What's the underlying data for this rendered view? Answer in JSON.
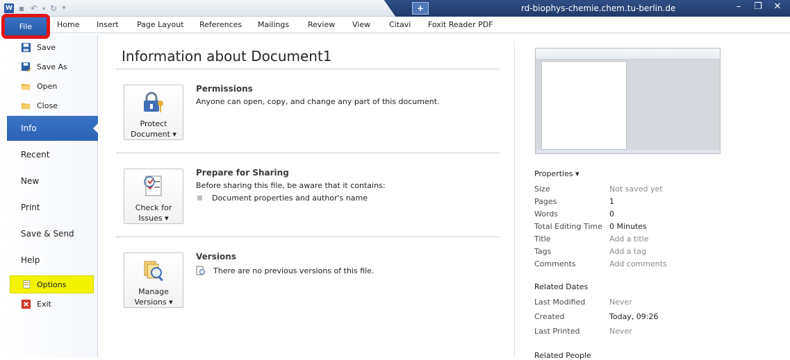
{
  "titlebar": {
    "window_title": "rd-biophys-chemie.chem.tu-berlin.de",
    "app_icon": "W",
    "citavi_symbol": "+"
  },
  "tabs": {
    "file": "File",
    "items": [
      "Home",
      "Insert",
      "Page Layout",
      "References",
      "Mailings",
      "Review",
      "View",
      "Citavi",
      "Foxit Reader PDF"
    ]
  },
  "backstage": {
    "commands": [
      "Save",
      "Save As",
      "Open",
      "Close"
    ],
    "info": "Info",
    "nav": [
      "Recent",
      "New",
      "Print",
      "Save & Send",
      "Help"
    ],
    "options": "Options",
    "exit": "Exit"
  },
  "main": {
    "title": "Information about Document1",
    "permissions": {
      "button_line1": "Protect",
      "button_line2": "Document ▾",
      "title": "Permissions",
      "text": "Anyone can open, copy, and change any part of this document."
    },
    "sharing": {
      "button_line1": "Check for",
      "button_line2": "Issues ▾",
      "title": "Prepare for Sharing",
      "text": "Before sharing this file, be aware that it contains:",
      "bullet": "Document properties and author's name"
    },
    "versions": {
      "button_line1": "Manage",
      "button_line2": "Versions ▾",
      "title": "Versions",
      "text": "There are no previous versions of this file."
    }
  },
  "properties": {
    "header": "Properties ▾",
    "rows": [
      {
        "label": "Size",
        "value": "Not saved yet",
        "muted": true
      },
      {
        "label": "Pages",
        "value": "1",
        "muted": false
      },
      {
        "label": "Words",
        "value": "0",
        "muted": false
      },
      {
        "label": "Total Editing Time",
        "value": "0 Minutes",
        "muted": false
      },
      {
        "label": "Title",
        "value": "Add a title",
        "muted": true
      },
      {
        "label": "Tags",
        "value": "Add a tag",
        "muted": true
      },
      {
        "label": "Comments",
        "value": "Add comments",
        "muted": true
      }
    ],
    "related_dates_header": "Related Dates",
    "dates": [
      {
        "label": "Last Modified",
        "value": "Never",
        "muted": true
      },
      {
        "label": "Created",
        "value": "Today, 09:26",
        "muted": false
      },
      {
        "label": "Last Printed",
        "value": "Never",
        "muted": true
      }
    ],
    "related_people_header": "Related People"
  },
  "colors": {
    "accent_blue": "#2b62b5",
    "highlight_red": "#e0151b",
    "highlight_yellow": "#f3f300"
  }
}
